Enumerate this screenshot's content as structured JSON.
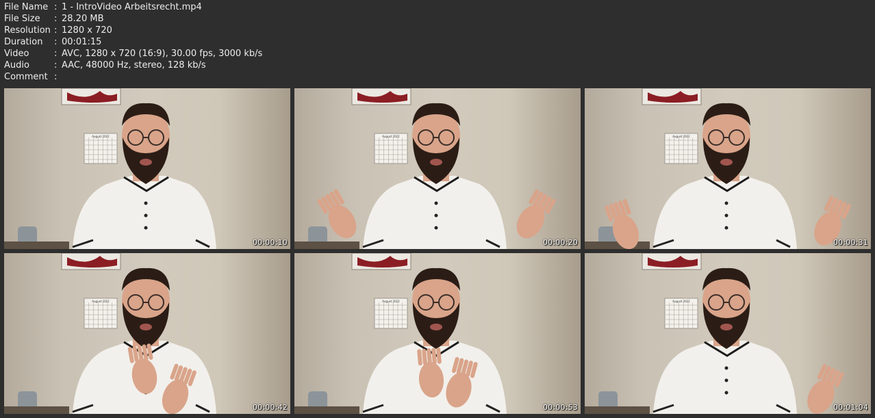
{
  "info": [
    {
      "label": "File Name",
      "value": "1 - IntroVideo Arbeitsrecht.mp4"
    },
    {
      "label": "File Size",
      "value": "28.20 MB"
    },
    {
      "label": "Resolution",
      "value": "1280 x 720"
    },
    {
      "label": "Duration",
      "value": "00:01:15"
    },
    {
      "label": "Video",
      "value": "AVC, 1280 x 720 (16:9), 30.00 fps, 3000 kb/s"
    },
    {
      "label": "Audio",
      "value": "AAC, 48000 Hz, stereo, 128 kb/s"
    },
    {
      "label": "Comment",
      "value": ""
    }
  ],
  "colon": ":",
  "thumbnails": [
    {
      "timestamp": "00:00:10"
    },
    {
      "timestamp": "00:00:20"
    },
    {
      "timestamp": "00:00:31"
    },
    {
      "timestamp": "00:00:42"
    },
    {
      "timestamp": "00:00:53"
    },
    {
      "timestamp": "00:01:04"
    }
  ],
  "calendar_label": "August 2022",
  "colors": {
    "background": "#2e2e2e",
    "text": "#ececec",
    "wall": "#cfc7b8",
    "shirt": "#f2f0ec",
    "beard": "#2b1d16",
    "skin": "#d9a48a"
  }
}
